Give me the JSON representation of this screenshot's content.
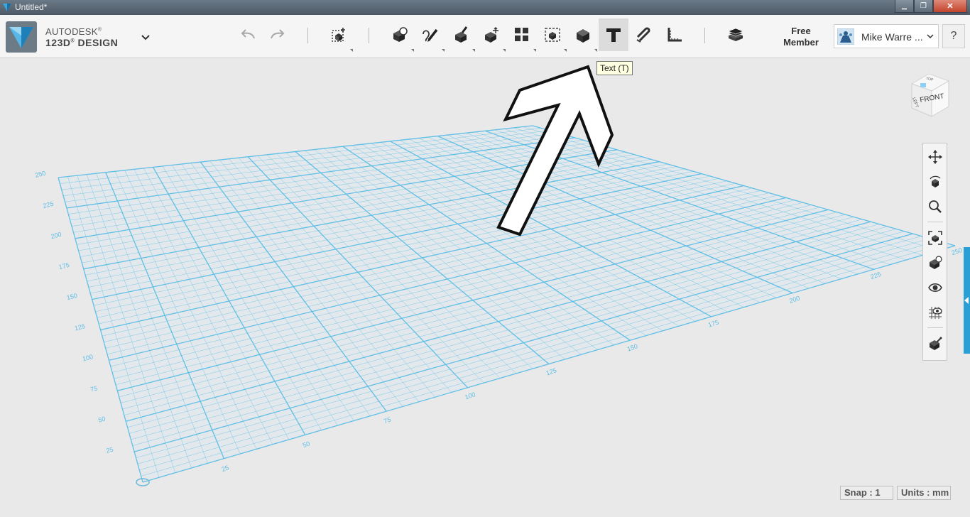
{
  "window": {
    "title": "Untitled*",
    "controls": {
      "minimize": "▁",
      "maximize": "❐",
      "close": "✕"
    }
  },
  "brand": {
    "line1": "AUTODESK",
    "line1_mark": "®",
    "line2": "123D",
    "line2_mark": "®",
    "line2_suffix": " DESIGN",
    "logo_icon": "autodesk-123d-logo"
  },
  "toolbar": {
    "tools": [
      {
        "id": "undo",
        "icon": "undo-arrow-icon"
      },
      {
        "id": "redo",
        "icon": "redo-arrow-icon"
      },
      {
        "id": "transform",
        "icon": "box-plus-icon"
      },
      {
        "id": "primitives",
        "icon": "primitives-icon"
      },
      {
        "id": "sketch",
        "icon": "sketch-icon"
      },
      {
        "id": "construct",
        "icon": "construct-icon"
      },
      {
        "id": "modify",
        "icon": "modify-icon"
      },
      {
        "id": "pattern",
        "icon": "pattern-icon"
      },
      {
        "id": "grouping",
        "icon": "grouping-icon"
      },
      {
        "id": "combine",
        "icon": "combine-icon"
      },
      {
        "id": "text",
        "icon": "text-t-icon",
        "active": true
      },
      {
        "id": "snap",
        "icon": "snap-magnet-icon"
      },
      {
        "id": "measure",
        "icon": "measure-ruler-icon"
      },
      {
        "id": "material",
        "icon": "material-layers-icon"
      }
    ],
    "membership_line1": "Free",
    "membership_line2": "Member",
    "account_name": "Mike Warre ...",
    "help_label": "?"
  },
  "tooltip": {
    "text": "Text (T)"
  },
  "viewcube": {
    "face_front": "FRONT",
    "face_left": "LEFT",
    "face_top": "TOP"
  },
  "grid": {
    "left_axis_labels": [
      "25",
      "50",
      "75",
      "100",
      "125",
      "150",
      "175",
      "200",
      "225",
      "250"
    ],
    "bottom_axis_labels": [
      "25",
      "50",
      "75",
      "100",
      "125",
      "150",
      "175",
      "200",
      "225",
      "250"
    ]
  },
  "status": {
    "snap": "Snap : 1",
    "units": "Units : mm"
  },
  "colors": {
    "accent": "#2a9fd6",
    "grid_line": "#5bbde6",
    "grid_fill": "#dde8ec",
    "background": "#e9e9e9"
  }
}
